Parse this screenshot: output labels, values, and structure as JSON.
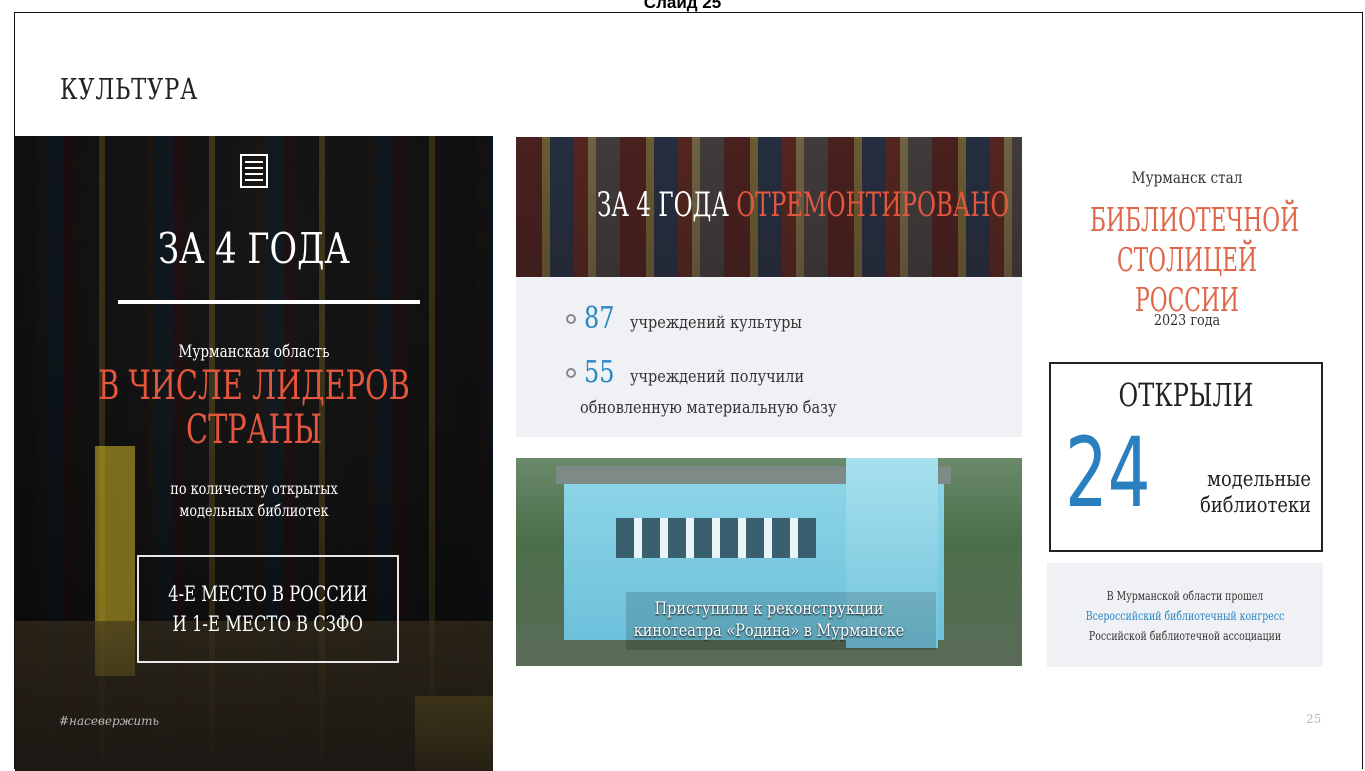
{
  "slide_caption": "Слайд 25",
  "section_title": "КУЛЬТУРА",
  "left_panel": {
    "heading": "ЗА 4 ГОДА",
    "region": "Мурманская область",
    "leaders_line1": "В ЧИСЛЕ ЛИДЕРОВ",
    "leaders_line2": "СТРАНЫ",
    "sub_line1": "по количеству открытых",
    "sub_line2": "модельных библиотек",
    "rank_line1": "4-Е МЕСТО В РОССИИ",
    "rank_line2": "И 1-Е МЕСТО В СЗФО",
    "hashtag": "#насевержить",
    "icon": "book-icon"
  },
  "middle": {
    "banner_white": "ЗА 4 ГОДА ",
    "banner_red": "ОТРЕМОНТИРОВАНО",
    "stat1_number": "87",
    "stat1_text": "учреждений культуры",
    "stat2_number": "55",
    "stat2_text": "учреждений получили",
    "stat2_text2": "обновленную материальную базу",
    "photo_caption_line1": "Приступили к реконструкции",
    "photo_caption_line2": "кинотеатра «Родина» в Мурманске"
  },
  "right": {
    "murmansk": "Мурманск стал",
    "capital_line1": "БИБЛИОТЕЧНОЙ",
    "capital_line2": "СТОЛИЦЕЙ РОССИИ",
    "year": "2023 года",
    "opened": "ОТКРЫЛИ",
    "number": "24",
    "model_line1": "модельные",
    "model_line2": "библиотеки",
    "congress_line1": "В Мурманской области прошел",
    "congress_line2": "Всероссийский библиотечный конгресс",
    "congress_line3": "Российской библиотечной ассоциации"
  },
  "page_number": "25",
  "colors": {
    "accent_red": "#e4563e",
    "accent_blue": "#2a86c4"
  }
}
